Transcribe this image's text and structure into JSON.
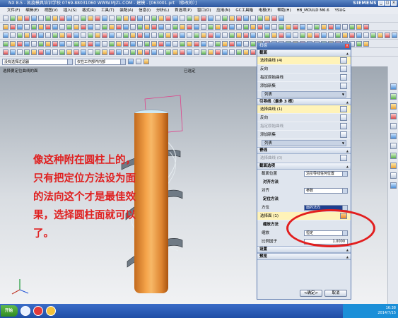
{
  "window": {
    "title": "NX 8.5 - 凯旋模具培训学校   0769-88031060   WWW.MJZL.COM  - 建模 - [063001.prt （修改的）]",
    "brand": "SIEMENS",
    "controls": [
      "_",
      "□",
      "×"
    ]
  },
  "menu": [
    "文件(F)",
    "编辑(E)",
    "视图(V)",
    "插入(S)",
    "格式(R)",
    "工具(T)",
    "装配(A)",
    "信息(I)",
    "分析(L)",
    "首选项(P)",
    "窗口(O)",
    "应用(N)",
    "GC工具箱",
    "电极(E)",
    "帮助(H)",
    "HB_MOULD M6.6",
    "YSUG"
  ],
  "filter": {
    "type_filter": "没有选择过滤器",
    "scope": "仅在工作部件内部"
  },
  "viewport": {
    "hint_left": "选择要定位曲线的面",
    "hint_right": "已选定"
  },
  "annotation": "像这种附在圆柱上的，只有把定位方法设为面的法向这个才是最佳效果，选择圆柱面就可以了。",
  "dialog": {
    "title": "扫掠",
    "close": "×",
    "section_curves": "截面",
    "curves_rows": [
      {
        "label": "选择曲线 (4)",
        "style": "sel"
      },
      {
        "label": "反向",
        "style": ""
      },
      {
        "label": "指定原始曲线",
        "style": ""
      },
      {
        "label": "添加新集",
        "style": ""
      }
    ],
    "list_label": "列表",
    "section_guides": "引导线（最多 3 根）",
    "guide_rows": [
      {
        "label": "选择曲线 (1)",
        "style": "sel"
      },
      {
        "label": "反向",
        "style": ""
      },
      {
        "label": "指定原始曲线",
        "style": "dim"
      },
      {
        "label": "添加新集",
        "style": ""
      }
    ],
    "list_label2": "列表",
    "section_spine": "脊线",
    "spine_row": "选择曲线 (0)",
    "section_options": "截面选项",
    "placement_label": "截面位置",
    "placement_value": "沿引导线任何位置",
    "align_head": "对齐方法",
    "align_label": "对齐",
    "align_value": "参数",
    "orient_head": "定位方法",
    "orient_label": "方位",
    "orient_value": "面的法向",
    "select_face": "选择面 (1)",
    "scale_head": "缩放方法",
    "scale_label": "缩放",
    "scale_value": "恒定",
    "ratio_label": "比例因子",
    "ratio_value": "1.0000",
    "section_settings": "设置",
    "section_preview": "预览",
    "ok": "<确定>",
    "cancel": "取消"
  },
  "taskbar": {
    "start": "开始",
    "time": "16:38",
    "date": "2014/7/15"
  }
}
